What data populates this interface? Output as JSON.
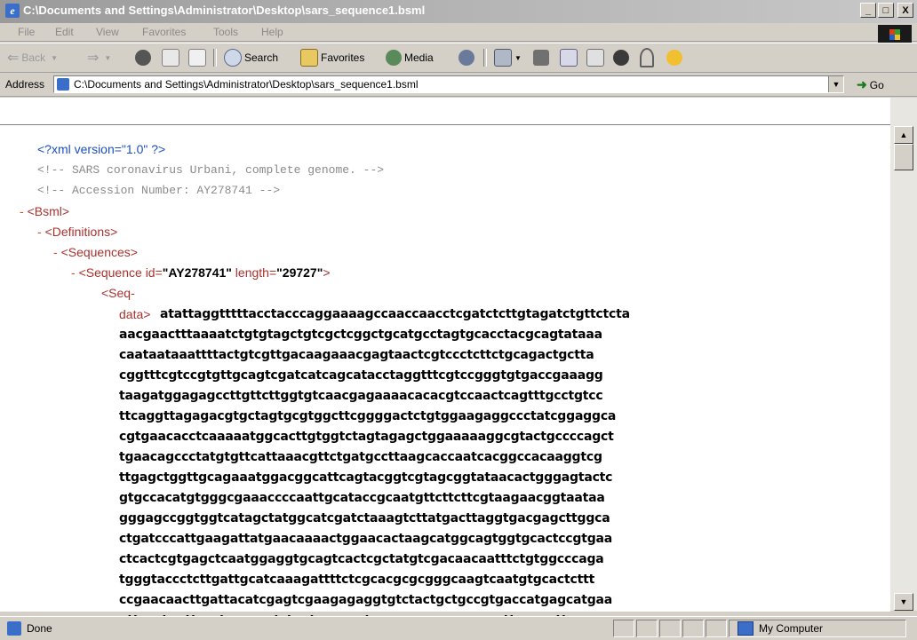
{
  "window": {
    "title": "C:\\Documents and Settings\\Administrator\\Desktop\\sars_sequence1.bsml",
    "minimize": "_",
    "maximize": "□",
    "close": "X"
  },
  "menu": [
    "File",
    "Edit",
    "View",
    "Favorites",
    "Tools",
    "Help"
  ],
  "toolbar": {
    "back": "Back",
    "search": "Search",
    "favorites": "Favorites",
    "media": "Media"
  },
  "address": {
    "label": "Address",
    "url": "C:\\Documents and Settings\\Administrator\\Desktop\\sars_sequence1.bsml",
    "go": "Go"
  },
  "xml": {
    "declaration": "<?xml version=\"1.0\" ?>",
    "comment1": "<!--   SARS coronavirus Urbani, complete genome.   -->",
    "comment2": "<!--   Accession Number:  AY278741     -->",
    "minus": "-",
    "bsml": "<Bsml>",
    "definitions": "<Definitions>",
    "sequences": "<Sequences>",
    "sequence_open": "<Sequence ",
    "attr_id": "id=",
    "id_value": "\"AY278741\"",
    "attr_length": " length=",
    "length_value": "\"29727\"",
    "sequence_close": ">",
    "seq_tag_1": "<Seq-",
    "seq_tag_2": "data>"
  },
  "sequence_lines": [
    "atattaggtttttacctacccaggaaaagccaaccaacctcgatctcttgtagatctgttctcta",
    "aacgaactttaaaatctgtgtagctgtcgctcggctgcatgcctagtgcacctacgcagtataaa",
    "caataataaattttactgtcgttgacaagaaacgagtaactcgtccctcttctgcagactgctta",
    "cggtttcgtccgtgttgcagtcgatcatcagcatacctaggtttcgtccgggtgtgaccgaaagg",
    "taagatggagagccttgttcttggtgtcaacgagaaaacacacgtccaactcagtttgcctgtcc",
    "ttcaggttagagacgtgctagtgcgtggcttcggggactctgtggaagaggccctatcggaggca",
    "cgtgaacacctcaaaaatggcacttgtggtctagtagagctggaaaaaggcgtactgccccagct",
    "tgaacagccctatgtgttcattaaacgttctgatgccttaagcaccaatcacggccacaaggtcg",
    "ttgagctggttgcagaaatggacggcattcagtacggtcgtagcggtataacactgggagtactc",
    "gtgccacatgtgggcgaaaccccaattgcataccgcaatgttcttcttcgtaagaacggtaataa",
    "gggagccggtggtcatagctatggcatcgatctaaagtcttatgacttaggtgacgagcttggca",
    "ctgatcccattgaagattatgaacaaaactggaacactaagcatggcagtggtgcactccgtgaa",
    "ctcactcgtgagctcaatggaggtgcagtcactcgctatgtcgacaacaatttctgtggcccaga",
    "tgggtaccctcttgattgcatcaaagattttctcgcacgcgcgggcaagtcaatgtgcactcttt",
    "ccgaacaacttgattacatcgagtcgaagagaggtgtctactgctgccgtgaccatgagcatgaa",
    "attgcctggttcactgagcgctctgataagagctacgagcaccagacacccttcgaaattaagag"
  ],
  "status": {
    "text": "Done",
    "zone": "My Computer"
  }
}
